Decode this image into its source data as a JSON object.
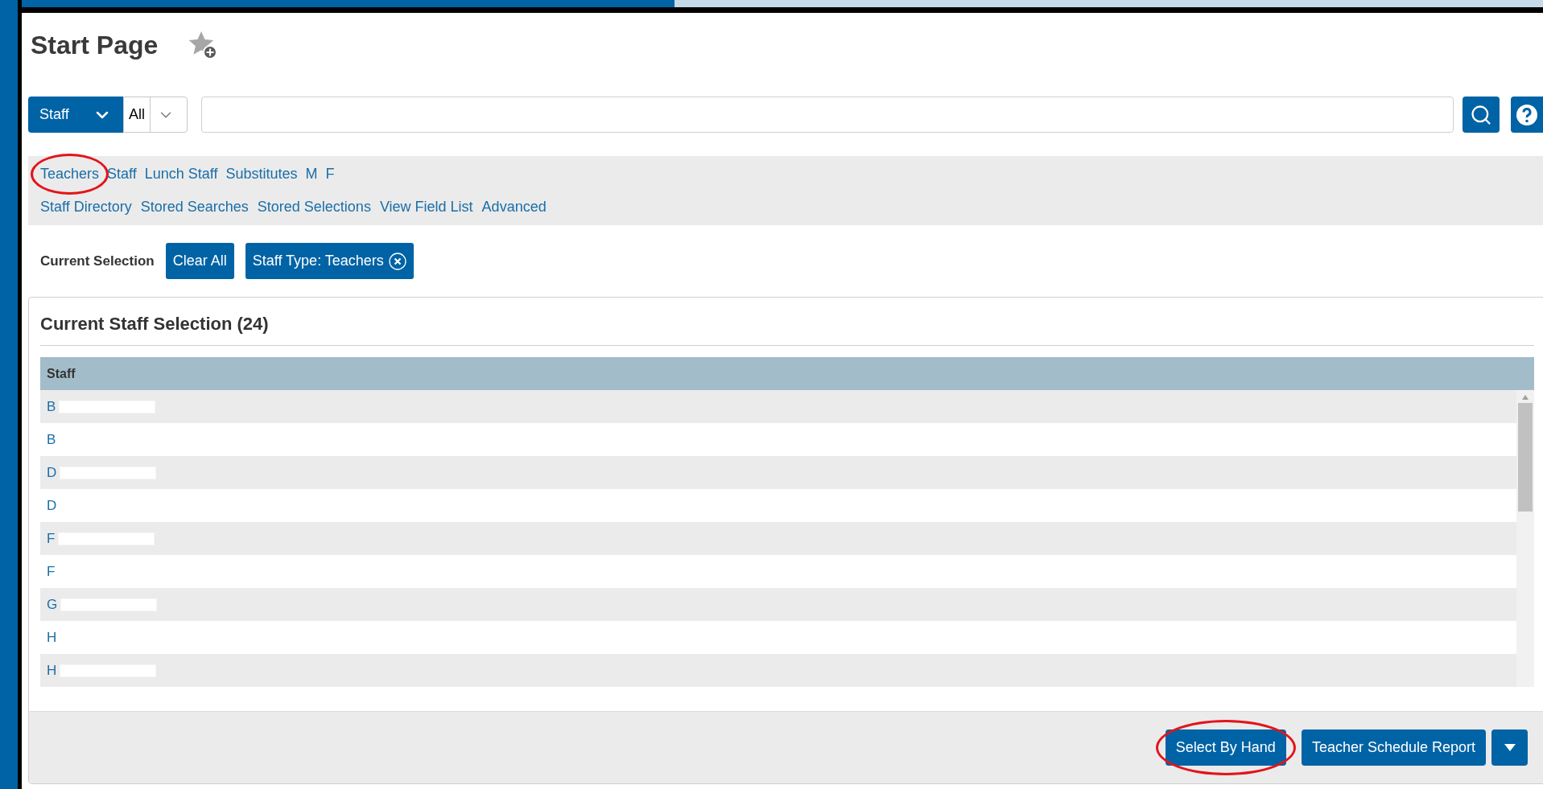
{
  "page": {
    "title": "Start Page"
  },
  "search": {
    "category": "Staff",
    "scope": "All"
  },
  "quick_links": [
    {
      "label": "Teachers",
      "highlighted": true
    },
    {
      "label": "Staff",
      "highlighted": false
    },
    {
      "label": "Lunch Staff",
      "highlighted": false
    },
    {
      "label": "Substitutes",
      "highlighted": false
    },
    {
      "label": "M",
      "highlighted": false
    },
    {
      "label": "F",
      "highlighted": false
    }
  ],
  "tool_links": [
    "Staff Directory",
    "Stored Searches",
    "Stored Selections",
    "View Field List",
    "Advanced"
  ],
  "current_selection": {
    "label": "Current Selection",
    "clear_button": "Clear All",
    "filters": [
      "Staff Type: Teachers"
    ]
  },
  "section": {
    "title": "Current Staff Selection (24)"
  },
  "table": {
    "columns": [
      "Staff"
    ],
    "rows": [
      {
        "name": "B",
        "redacted": true
      },
      {
        "name": "B",
        "redacted": false
      },
      {
        "name": "D",
        "redacted": true
      },
      {
        "name": "D",
        "redacted": false
      },
      {
        "name": "F",
        "redacted": true
      },
      {
        "name": "F",
        "redacted": false
      },
      {
        "name": "G",
        "redacted": true
      },
      {
        "name": "H",
        "redacted": false
      },
      {
        "name": "H",
        "redacted": true
      }
    ]
  },
  "actions": [
    {
      "label": "Select By Hand",
      "highlighted": true
    },
    {
      "label": "Teacher Schedule Report",
      "highlighted": false
    }
  ]
}
